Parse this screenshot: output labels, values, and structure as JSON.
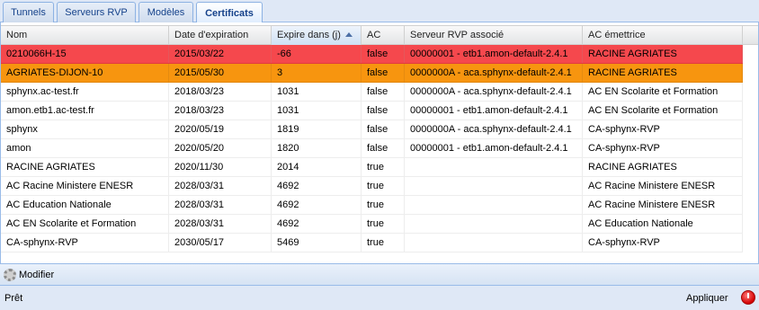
{
  "tabs": [
    {
      "label": "Tunnels"
    },
    {
      "label": "Serveurs RVP"
    },
    {
      "label": "Modèles"
    },
    {
      "label": "Certificats"
    }
  ],
  "active_tab": "Certificats",
  "grid": {
    "columns": [
      {
        "label": "Nom"
      },
      {
        "label": "Date d'expiration"
      },
      {
        "label": "Expire dans (j)",
        "sorted": "asc"
      },
      {
        "label": "AC"
      },
      {
        "label": "Serveur RVP associé"
      },
      {
        "label": "AC émettrice"
      }
    ],
    "rows": [
      {
        "nom": "0210066H-15",
        "date": "2015/03/22",
        "expire": "-66",
        "ac": "false",
        "serveur": "00000001 - etb1.amon-default-2.4.1",
        "emettrice": "RACINE AGRIATES",
        "status": "expired"
      },
      {
        "nom": "AGRIATES-DIJON-10",
        "date": "2015/05/30",
        "expire": "3",
        "ac": "false",
        "serveur": "0000000A - aca.sphynx-default-2.4.1",
        "emettrice": "RACINE AGRIATES",
        "status": "expiring"
      },
      {
        "nom": "sphynx.ac-test.fr",
        "date": "2018/03/23",
        "expire": "1031",
        "ac": "false",
        "serveur": "0000000A - aca.sphynx-default-2.4.1",
        "emettrice": "AC EN Scolarite et Formation",
        "status": "ok"
      },
      {
        "nom": "amon.etb1.ac-test.fr",
        "date": "2018/03/23",
        "expire": "1031",
        "ac": "false",
        "serveur": "00000001 - etb1.amon-default-2.4.1",
        "emettrice": "AC EN Scolarite et Formation",
        "status": "ok"
      },
      {
        "nom": "sphynx",
        "date": "2020/05/19",
        "expire": "1819",
        "ac": "false",
        "serveur": "0000000A - aca.sphynx-default-2.4.1",
        "emettrice": "CA-sphynx-RVP",
        "status": "ok"
      },
      {
        "nom": "amon",
        "date": "2020/05/20",
        "expire": "1820",
        "ac": "false",
        "serveur": "00000001 - etb1.amon-default-2.4.1",
        "emettrice": "CA-sphynx-RVP",
        "status": "ok"
      },
      {
        "nom": "RACINE AGRIATES",
        "date": "2020/11/30",
        "expire": "2014",
        "ac": "true",
        "serveur": "",
        "emettrice": "RACINE AGRIATES",
        "status": "ok"
      },
      {
        "nom": "AC Racine Ministere ENESR",
        "date": "2028/03/31",
        "expire": "4692",
        "ac": "true",
        "serveur": "",
        "emettrice": "AC Racine Ministere ENESR",
        "status": "ok"
      },
      {
        "nom": "AC Education Nationale",
        "date": "2028/03/31",
        "expire": "4692",
        "ac": "true",
        "serveur": "",
        "emettrice": "AC Racine Ministere ENESR",
        "status": "ok"
      },
      {
        "nom": "AC EN Scolarite et Formation",
        "date": "2028/03/31",
        "expire": "4692",
        "ac": "true",
        "serveur": "",
        "emettrice": "AC Education Nationale",
        "status": "ok"
      },
      {
        "nom": "CA-sphynx-RVP",
        "date": "2030/05/17",
        "expire": "5469",
        "ac": "true",
        "serveur": "",
        "emettrice": "CA-sphynx-RVP",
        "status": "ok"
      }
    ]
  },
  "toolbar": {
    "modifier_label": "Modifier",
    "modifier_icon": "gear-icon"
  },
  "status_bar": {
    "text": "Prêt",
    "apply_label": "Appliquer",
    "power_icon": "power-icon"
  },
  "colors": {
    "expired_row": "#f5484d",
    "expiring_row": "#f7950f",
    "accent": "#99bbe8"
  }
}
